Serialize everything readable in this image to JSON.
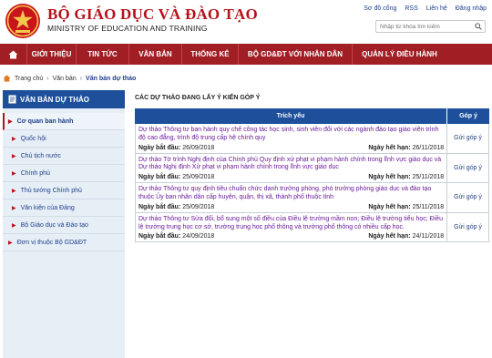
{
  "header": {
    "title": "BỘ GIÁO DỤC VÀ ĐÀO TẠO",
    "subtitle": "MINISTRY OF EDUCATION AND TRAINING",
    "toplinks": [
      "Sơ đồ cổng",
      "RSS",
      "Liên hệ",
      "Đăng nhập"
    ],
    "search_placeholder": "Nhập từ khóa tìm kiếm"
  },
  "nav": {
    "items": [
      "GIỚI THIỆU",
      "TIN TỨC",
      "VĂN BẢN",
      "THỐNG KÊ",
      "BỘ GD&ĐT VỚI NHÂN DÂN",
      "QUẢN LÝ ĐIỀU HÀNH"
    ]
  },
  "breadcrumb": {
    "items": [
      "Trang chủ",
      "Văn bản",
      "Văn bản dự thảo"
    ]
  },
  "sidebar": {
    "heading": "VĂN BẢN DỰ THẢO",
    "items": [
      "Cơ quan ban hành",
      "Quốc hội",
      "Chủ tịch nước",
      "Chính phủ",
      "Thủ tướng Chính phủ",
      "Văn kiện của Đảng",
      "Bộ Giáo dục và Đào tạo",
      "Đơn vị thuộc Bộ GD&ĐT"
    ]
  },
  "main": {
    "title": "CÁC DỰ THẢO ĐANG LẤY Ý KIẾN GÓP Ý",
    "columns": [
      "Trích yếu",
      "Góp ý"
    ],
    "start_label": "Ngày bắt đầu:",
    "end_label": "Ngày hết hạn:",
    "action_label": "Gửi góp ý",
    "rows": [
      {
        "summary": "Dự thảo Thông tư ban hành quy chế công tác học sinh, sinh viên đối với các ngành đào tạo giáo viên trình độ cao đẳng, trình độ trung cấp hệ chính quy",
        "start": "26/09/2018",
        "end": "26/11/2018"
      },
      {
        "summary": "Dự thảo Tờ trình Nghị định của Chính phủ Quy định xử phạt vi phạm hành chính trong lĩnh vực giáo dục và Dự thảo Nghị định Xử phạt vi phạm hành chính trong lĩnh vực giáo dục",
        "start": "25/09/2018",
        "end": "25/11/2018"
      },
      {
        "summary": "Dự thảo Thông tư quy định tiêu chuẩn chức danh trưởng phòng, phó trưởng phòng giáo dục và đào tạo thuộc Ủy ban nhân dân cấp huyện, quận, thị xã, thành phố thuộc tỉnh",
        "start": "25/09/2018",
        "end": "25/11/2018"
      },
      {
        "summary": "Dự thảo Thông tư Sửa đổi, bổ sung một số điều của Điều lệ trường mầm non; Điều lệ trường tiểu học; Điều lệ trường trung học cơ sở, trường trung học phổ thông và trường phổ thông có nhiều cấp học.",
        "start": "24/09/2018",
        "end": "24/11/2018"
      }
    ]
  },
  "colors": {
    "brand_red": "#b5121b",
    "nav_red": "#a11e24",
    "blue": "#1d4f9a",
    "link_purple": "#6a1b9a"
  }
}
